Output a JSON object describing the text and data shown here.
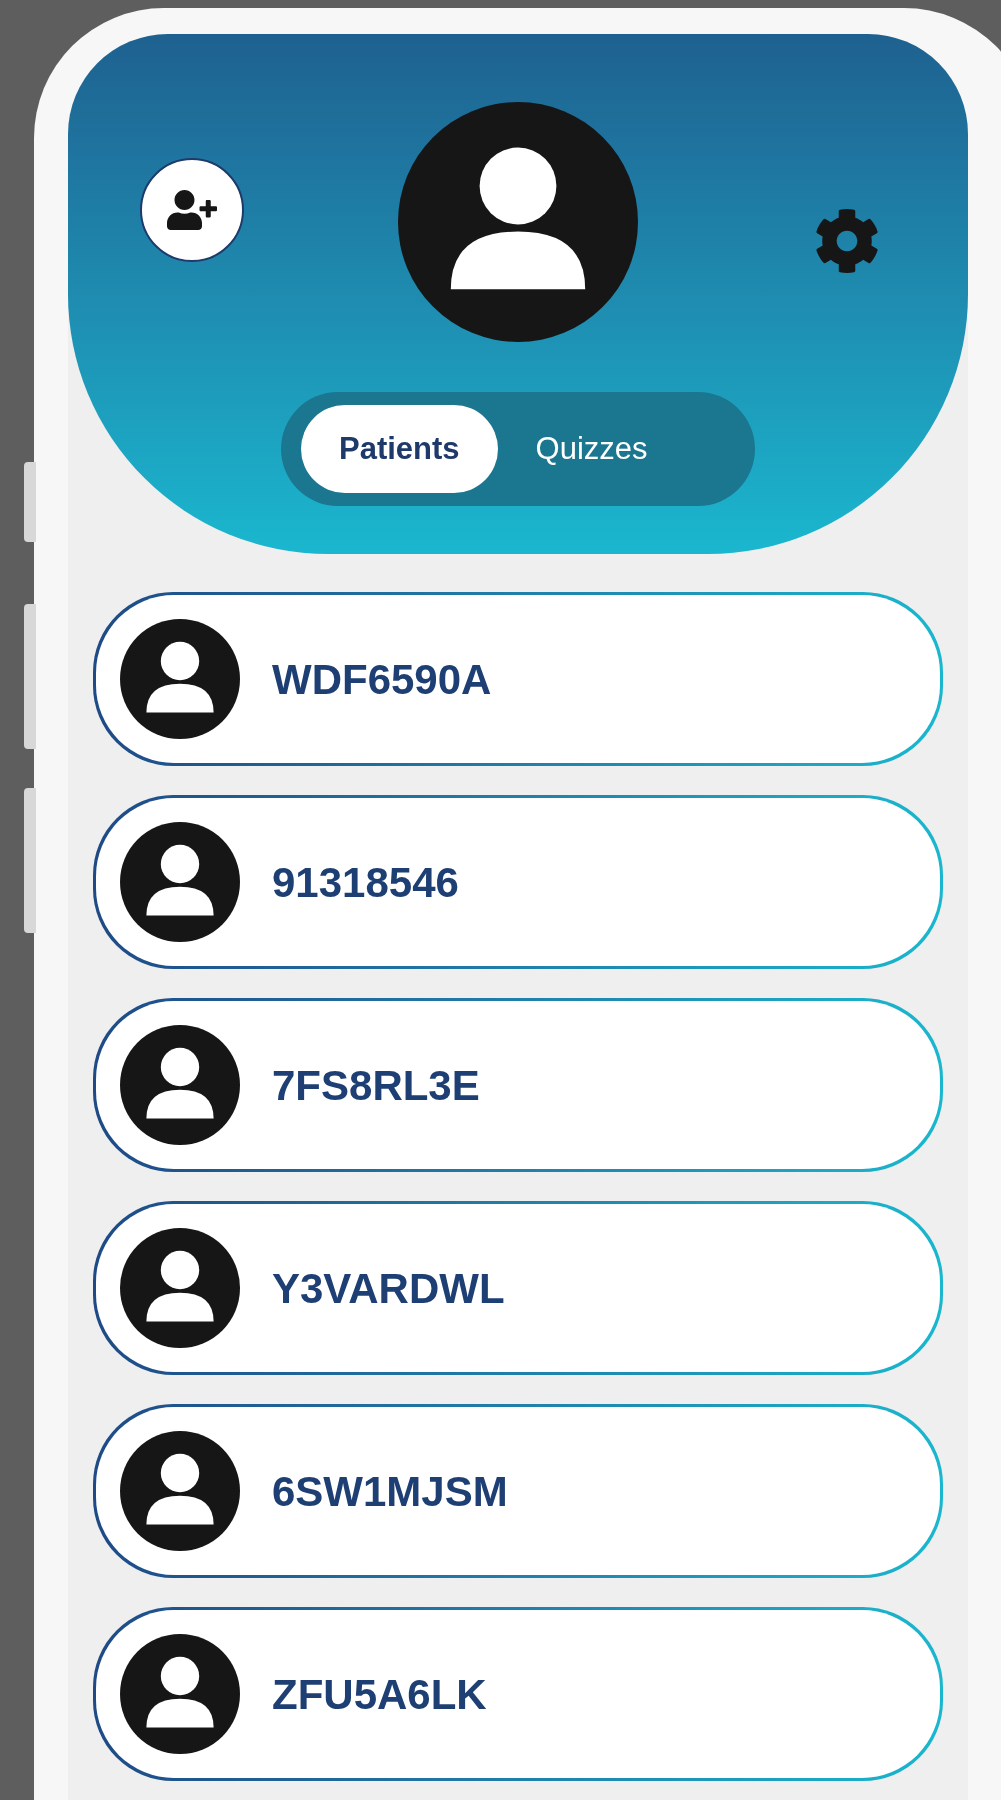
{
  "header": {
    "tabs": [
      {
        "label": "Patients",
        "selected": true
      },
      {
        "label": "Quizzes",
        "selected": false
      }
    ]
  },
  "patients": [
    {
      "id": "WDF6590A"
    },
    {
      "id": "91318546"
    },
    {
      "id": "7FS8RL3E"
    },
    {
      "id": "Y3VARDWL"
    },
    {
      "id": "6SW1MJSM"
    },
    {
      "id": "ZFU5A6LK"
    }
  ]
}
